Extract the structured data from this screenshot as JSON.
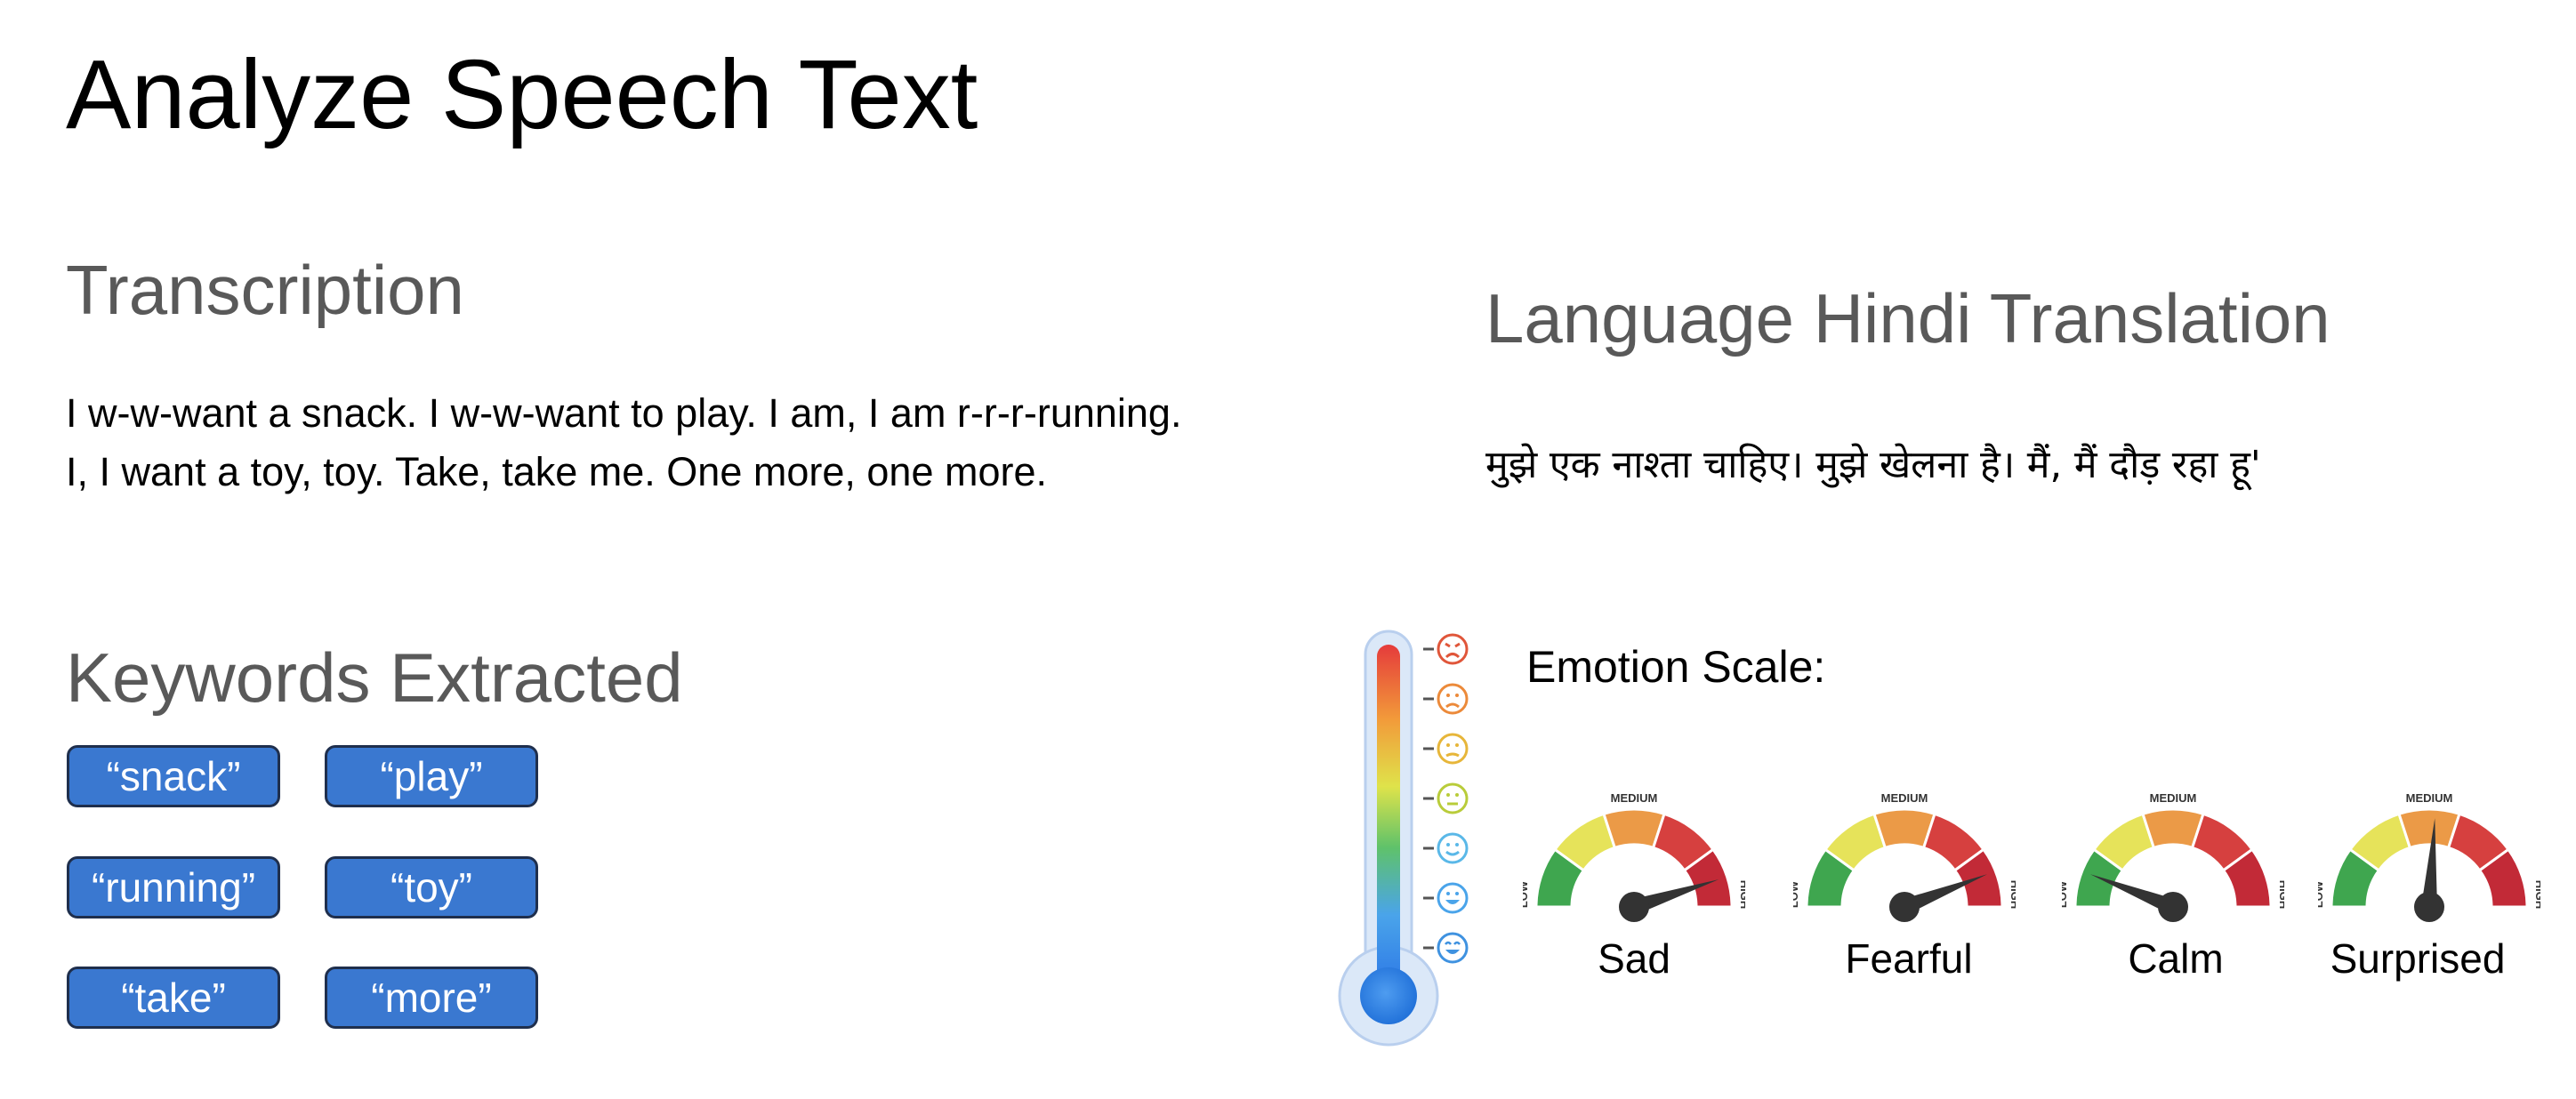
{
  "page": {
    "title": "Analyze Speech Text"
  },
  "transcription": {
    "heading": "Transcription",
    "line1": "I w-w-want a snack. I w-w-want to play. I am, I am r-r-r-running.",
    "line2": "I, I want a toy, toy. Take, take me. One more, one more."
  },
  "translation": {
    "heading": "Language Hindi Translation",
    "text": "मुझे एक नाश्ता चाहिए। मुझे खेलना है। मैं, मैं दौड़ रहा हू'"
  },
  "keywords": {
    "heading": "Keywords Extracted",
    "items": [
      "“snack”",
      "“play”",
      "“running”",
      "“toy”",
      "“take”",
      "“more”"
    ]
  },
  "emotion": {
    "label": "Emotion Scale:",
    "scale_words": {
      "low": "LOW",
      "medium": "MEDIUM",
      "high": "HIGH"
    },
    "gauges": [
      {
        "name": "Sad",
        "level": 0.9
      },
      {
        "name": "Fearful",
        "level": 0.88
      },
      {
        "name": "Calm",
        "level": 0.12
      },
      {
        "name": "Surprised",
        "level": 0.52
      }
    ],
    "thermometer_faces": [
      "angry-face-icon",
      "frown-face-icon",
      "sad-face-icon",
      "neutral-face-icon",
      "smile-face-icon",
      "happy-face-icon",
      "grin-face-icon"
    ]
  },
  "colors": {
    "chip_fill": "#3a78d0",
    "gauge_green": "#3fa64f",
    "gauge_yellow": "#e6e35a",
    "gauge_orange": "#eb9a47",
    "gauge_red": "#d6403f",
    "gauge_darkred": "#c22a37",
    "needle": "#333333"
  }
}
